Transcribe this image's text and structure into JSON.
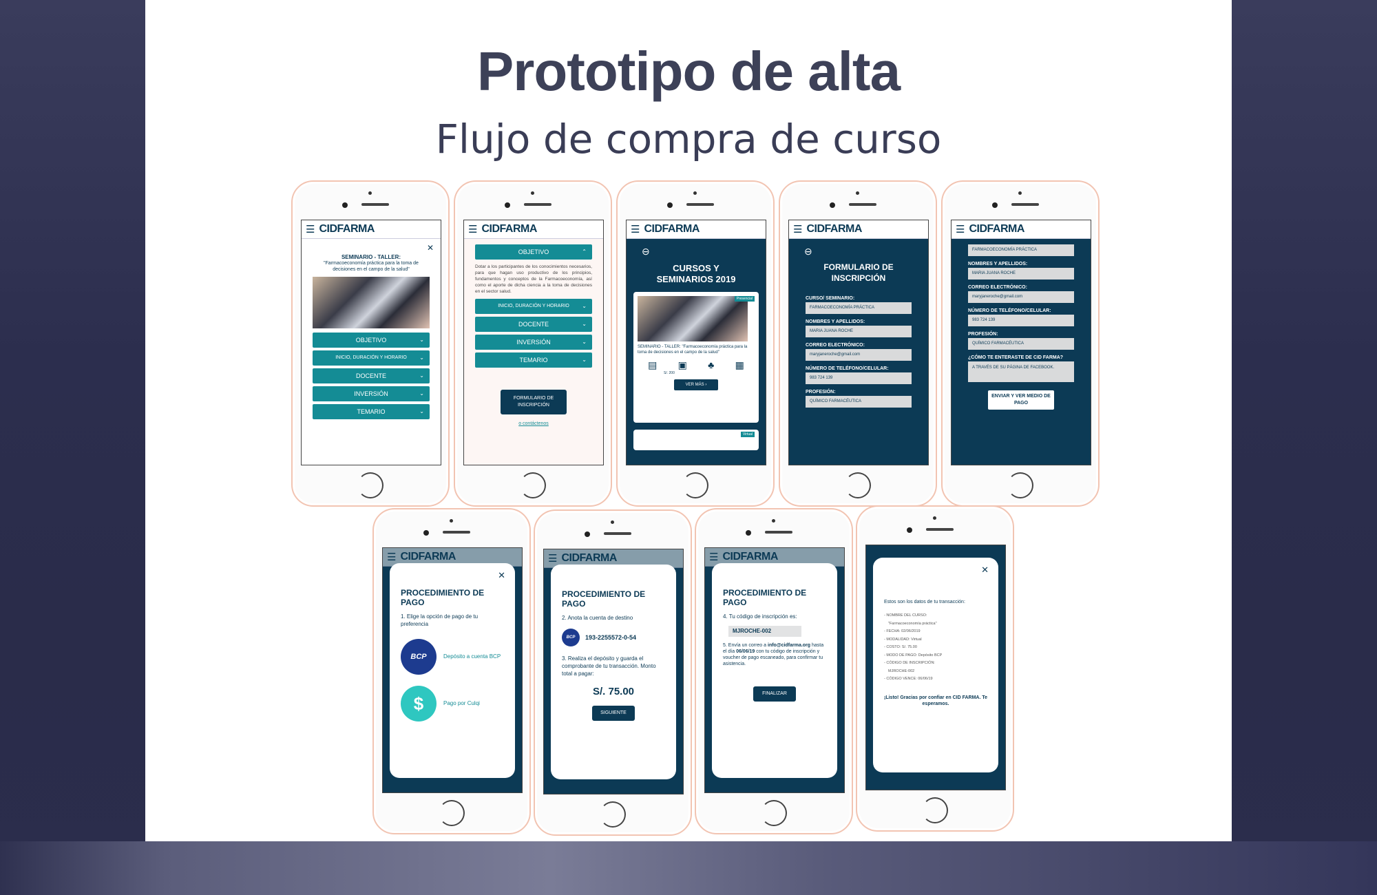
{
  "slide": {
    "title": "Prototipo de alta",
    "subtitle": "Flujo de compra de curso"
  },
  "brand": {
    "logo": "CIDFARMA",
    "colors": {
      "navy": "#0c3a55",
      "teal": "#148c95",
      "background": "#2c2e4e"
    }
  },
  "screen1": {
    "heading": "SEMINARIO - TALLER:",
    "course": "\"Farmacoeconomía práctica para la toma de decisiones en el campo de la salud\"",
    "buttons": [
      "OBJETIVO",
      "INICIO, DURACIÓN Y HORARIO",
      "DOCENTE",
      "INVERSIÓN",
      "TEMARIO"
    ]
  },
  "screen2": {
    "objetivo_label": "OBJETIVO",
    "objetivo_text": "Dotar a los participantes de los conocimientos necesarios, para que hagan uso productivo de los principios, fundamentos y conceptos de la Farmacoeconomía, así como el aporte de dicha ciencia a la toma de decisiones en el sector salud.",
    "buttons": [
      "INICIO, DURACIÓN Y HORARIO",
      "DOCENTE",
      "INVERSIÓN",
      "TEMARIO"
    ],
    "form_button": "FORMULARIO DE INSCRIPCIÓN",
    "contact_link": "o contáctenos"
  },
  "screen3": {
    "title": "CURSOS Y SEMINARIOS 2019",
    "badge": "Presencial",
    "card_text": "SEMINARIO - TALLER: \"Farmacoeconomía práctica para la toma de decisiones en el campo de la salud\"",
    "price": "S/. 200",
    "more_button": "VER MÁS",
    "badge2": "Virtual"
  },
  "screen4": {
    "title": "FORMULARIO DE INSCRIPCIÓN",
    "fields": [
      {
        "label": "CURSO/ SEMINARIO:",
        "value": "FARMACOECONOMÍA PRÁCTICA"
      },
      {
        "label": "NOMBRES Y APELLIDOS:",
        "value": "MARIA JUANA ROCHE"
      },
      {
        "label": "CORREO ELECTRÓNICO:",
        "value": "maryjaneroche@gmail.com"
      },
      {
        "label": "NÚMERO DE TELÉFONO/CELULAR:",
        "value": "983 724 139"
      },
      {
        "label": "PROFESIÓN:",
        "value": "QUÍMICO FARMACÉUTICA"
      }
    ]
  },
  "screen5": {
    "top_value": "FARMACOECONOMÍA PRÁCTICA",
    "fields": [
      {
        "label": "NOMBRES Y APELLIDOS:",
        "value": "MARIA JUANA ROCHE"
      },
      {
        "label": "CORREO ELECTRÓNICO:",
        "value": "maryjaneroche@gmail.com"
      },
      {
        "label": "NÚMERO DE TELÉFONO/CELULAR:",
        "value": "983 724 139"
      },
      {
        "label": "PROFESIÓN:",
        "value": "QUÍMICO FARMACÉUTICA"
      },
      {
        "label": "¿CÓMO TE ENTERASTE DE CID FARMA?",
        "value": "A TRAVÉS DE SU PÁGINA DE FACEBOOK."
      }
    ],
    "submit": "ENVIAR Y VER MEDIO DE PAGO"
  },
  "screen6": {
    "title": "PROCEDIMIENTO DE PAGO",
    "step": "1. Elige la opción de pago de tu preferencia",
    "option1_icon": "BCP",
    "option1": "Depósito a cuenta BCP",
    "option2_icon": "$",
    "option2": "Pago por Culqi"
  },
  "screen7": {
    "title": "PROCEDIMIENTO DE PAGO",
    "step2": "2. Anota la cuenta de destino",
    "bank_icon": "BCP",
    "account": "193-2255572-0-54",
    "step3": "3. Realiza el depósito y guarda el comprobante de tu transacción. Monto total a pagar:",
    "amount": "S/. 75.00",
    "next": "SIGUIENTE"
  },
  "screen8": {
    "title": "PROCEDIMIENTO DE PAGO",
    "step4": "4. Tu código de inscripción es:",
    "code": "MJROCHE-002",
    "step5_prefix": "5. Envía un correo a",
    "email": "info@cidfarma.org",
    "step5_mid": "hasta el día",
    "date": "06/06/19",
    "step5_suffix": "con tu código de inscripción y voucher de pago escaneado, para confirmar tu asistencia.",
    "finish": "FINALIZAR"
  },
  "screen9": {
    "intro": "Estos son los datos de tu transacción:",
    "items": [
      "- NOMBRE DEL CURSO:",
      "\"Farmacoeconomía práctica\"",
      "- FECHA: 02/06/2019",
      "- MODALIDAD: Virtual",
      "- COSTO: S/. 75.00",
      "- MODO DE PAGO: Depósito BCP",
      "- CÓDIGO DE INSCRIPCIÓN:",
      "MJROCHE-002",
      "- CÓDIGO VENCE: 06/06/19"
    ],
    "closing": "¡Listo! Gracias por confiar en CID FARMA. Te esperamos."
  }
}
